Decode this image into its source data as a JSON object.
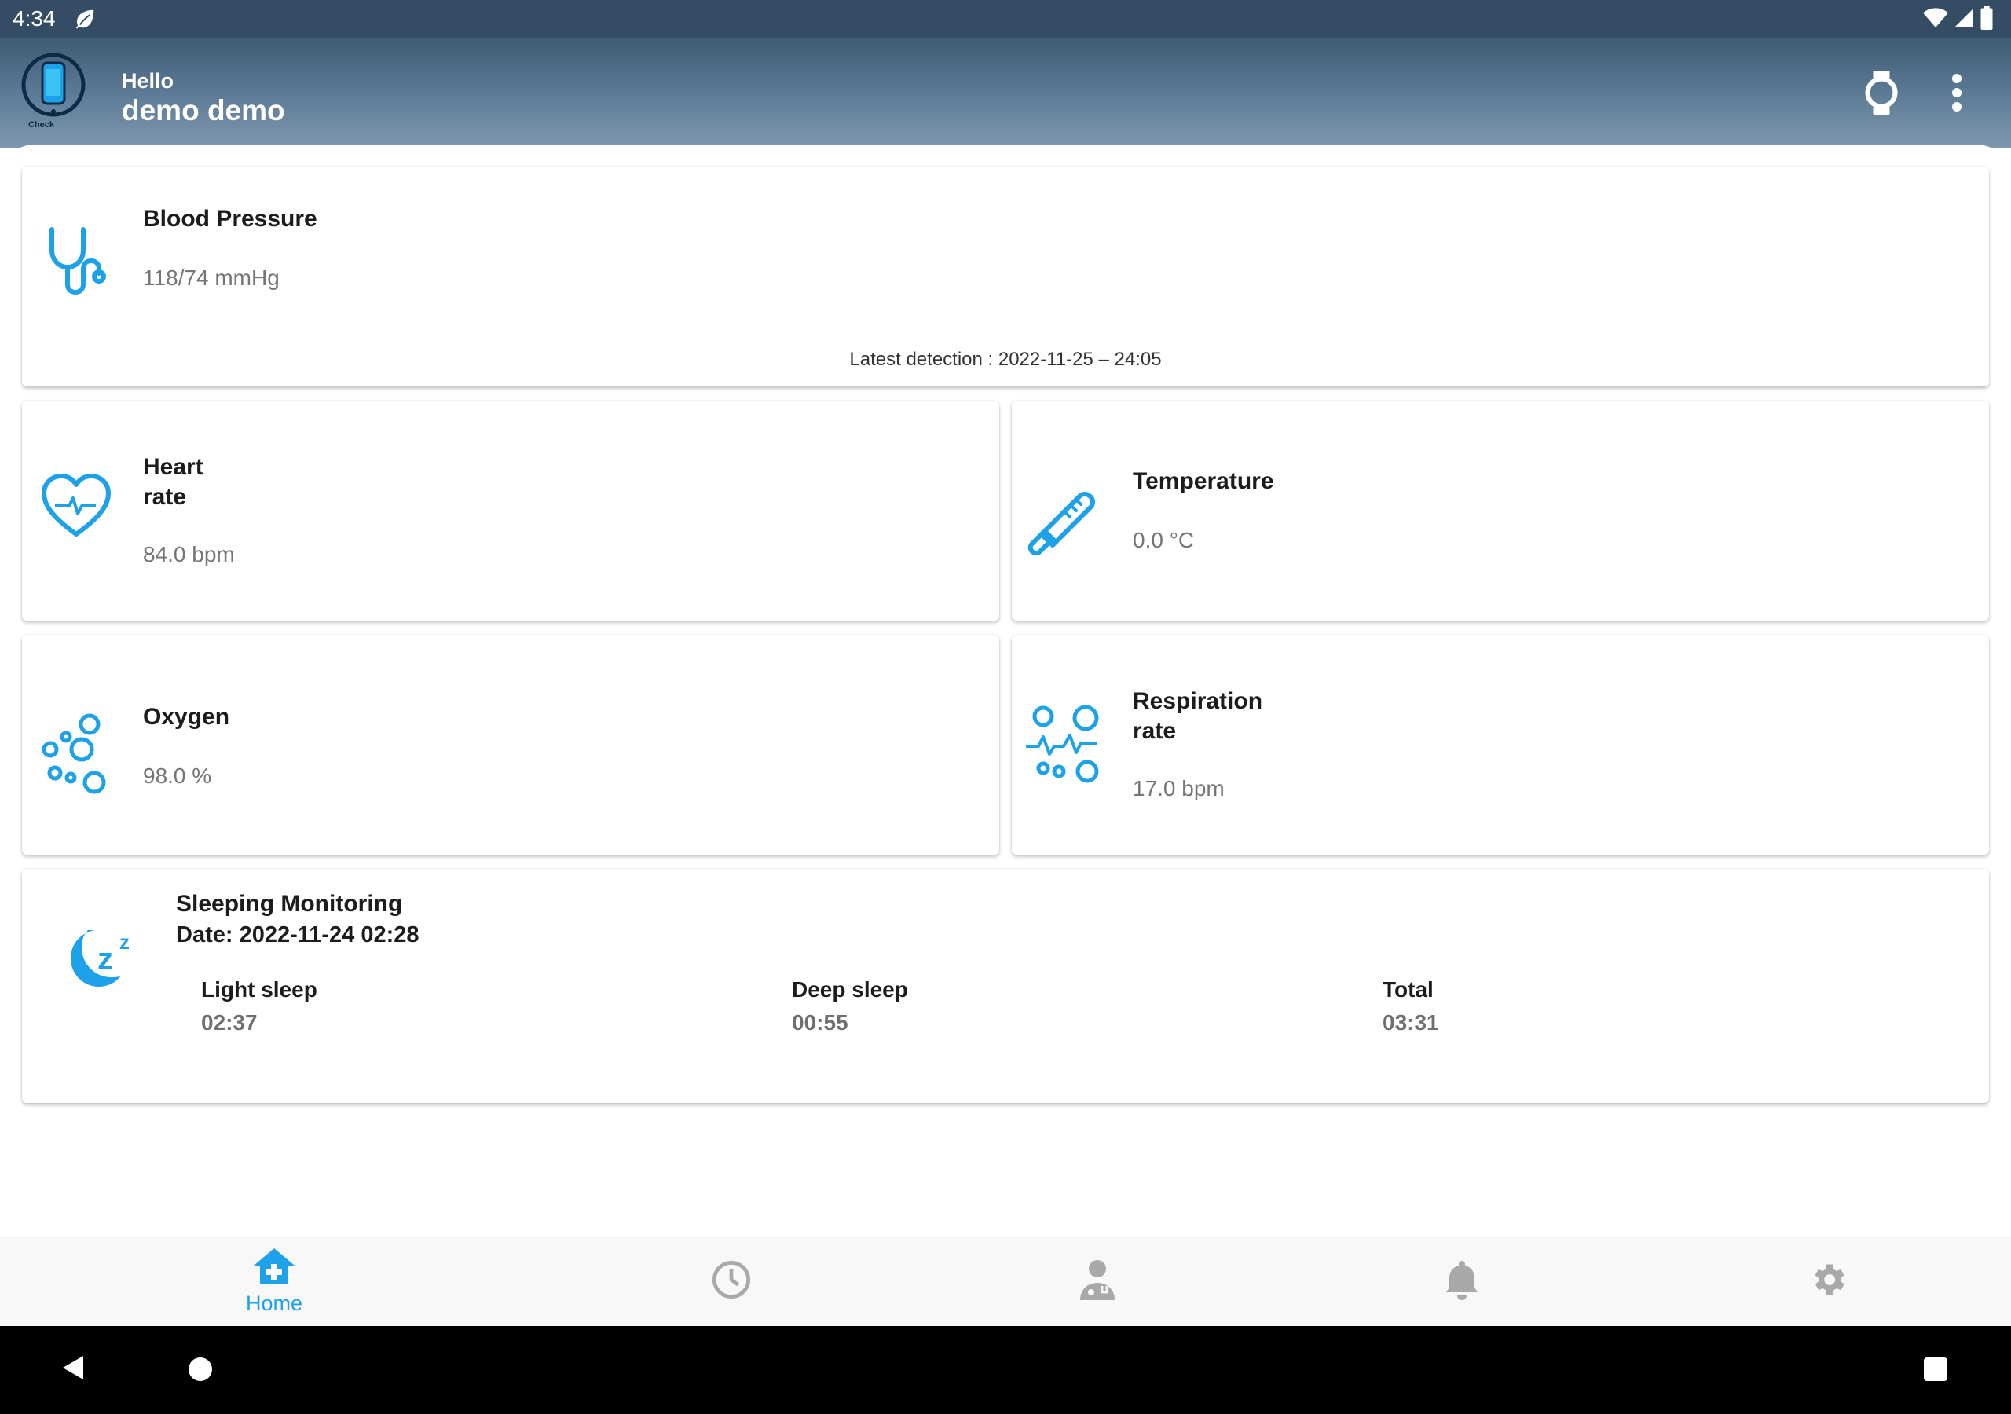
{
  "status_bar": {
    "time": "4:34"
  },
  "header": {
    "greeting": "Hello",
    "user_name": "demo demo",
    "logo_text": "Check",
    "icons": [
      "watch-icon",
      "more-vert-icon"
    ]
  },
  "cards": {
    "blood_pressure": {
      "title": "Blood Pressure",
      "value": "118/74 mmHg",
      "latest": "Latest detection : 2022-11-25 – 24:05",
      "icon": "stethoscope-icon"
    },
    "heart_rate": {
      "title_line1": "Heart",
      "title_line2": "rate",
      "value": "84.0 bpm",
      "icon": "heart-pulse-icon"
    },
    "temperature": {
      "title": "Temperature",
      "value": "0.0 °C",
      "icon": "thermometer-icon"
    },
    "oxygen": {
      "title": "Oxygen",
      "value": "98.0 %",
      "icon": "oxygen-bubbles-icon"
    },
    "respiration": {
      "title_line1": "Respiration",
      "title_line2": "rate",
      "value": "17.0 bpm",
      "icon": "respiration-icon"
    }
  },
  "sleep": {
    "title": "Sleeping Monitoring",
    "date": "Date: 2022-11-24 02:28",
    "icon": "sleep-moon-icon",
    "columns": [
      {
        "label": "Light sleep",
        "value": "02:37"
      },
      {
        "label": "Deep sleep",
        "value": "00:55"
      },
      {
        "label": "Total",
        "value": "03:31"
      }
    ]
  },
  "bottom_nav": {
    "active": "Home",
    "items": [
      {
        "label": "Home",
        "icon": "home-medical-icon"
      },
      {
        "label": "",
        "icon": "history-clock-icon"
      },
      {
        "label": "",
        "icon": "doctor-icon"
      },
      {
        "label": "",
        "icon": "bell-icon"
      },
      {
        "label": "",
        "icon": "settings-gear-icon"
      }
    ]
  },
  "colors": {
    "accent": "#1da1e8",
    "header_top": "#344d64",
    "icon_gray": "#a9a9a9"
  }
}
